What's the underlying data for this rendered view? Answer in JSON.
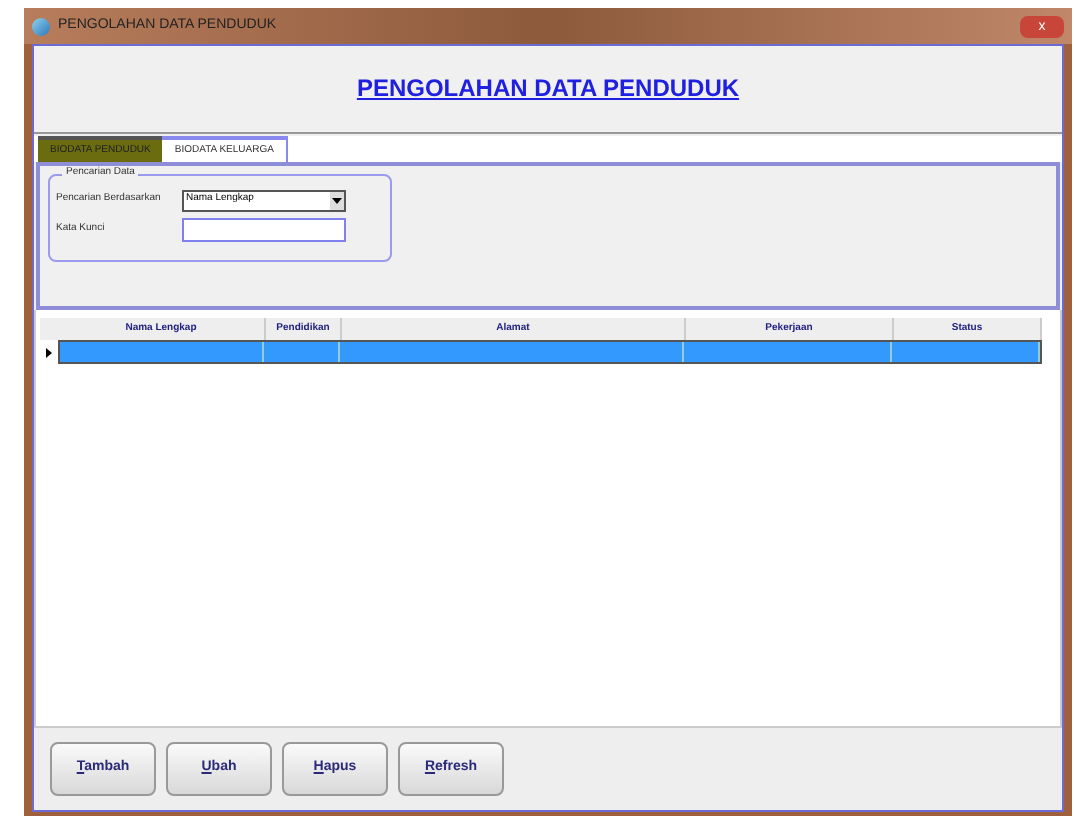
{
  "window": {
    "title": "PENGOLAHAN DATA PENDUDUK",
    "close": "x"
  },
  "heading": "PENGOLAHAN DATA PENDUDUK",
  "tabs": [
    {
      "label": "BIODATA PENDUDUK",
      "selected": true
    },
    {
      "label": "BIODATA KELUARGA",
      "selected": false
    }
  ],
  "search": {
    "group_title": "Pencarian Data",
    "by_label": "Pencarian Berdasarkan",
    "by_value": "Nama Lengkap",
    "keyword_label": "Kata Kunci"
  },
  "table": {
    "columns": [
      "Nama Lengkap",
      "Pendidikan",
      "Alamat",
      "Pekerjaan",
      "Status"
    ],
    "rows": [
      {
        "selected": true
      }
    ]
  },
  "buttons": [
    "Tambah",
    "Ubah",
    "Hapus",
    "Refresh"
  ]
}
